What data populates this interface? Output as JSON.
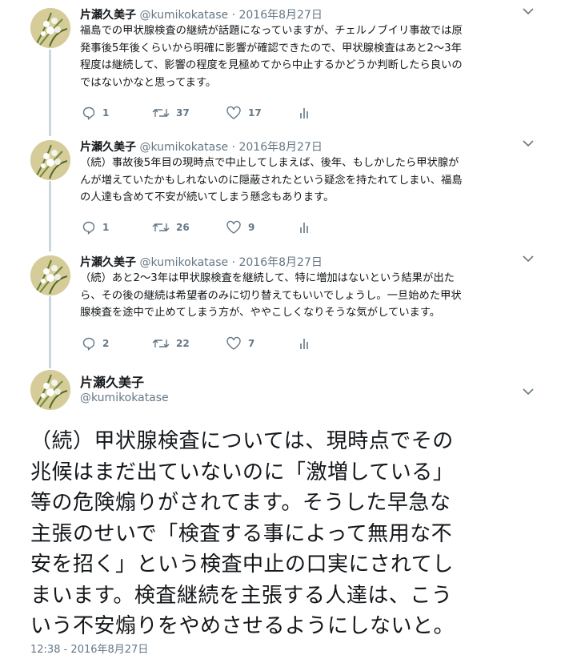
{
  "tweets": [
    {
      "name": "片瀬久美子",
      "handle": "@kumikokatase",
      "dot": "·",
      "date": "2016年8月27日",
      "text": "福島での甲状腺検査の継続が話題になっていますが、チェルノブイリ事故では原\n発事後5年後くらいから明確に影響が確認できたので、甲状腺検査はあと2〜3年\n程度は継続して、影響の程度を見極めてから中止するかどうか判断したら良いの\nではないかなと思ってます。",
      "replies": "1",
      "retweets": "37",
      "likes": "17"
    },
    {
      "name": "片瀬久美子",
      "handle": "@kumikokatase",
      "dot": "·",
      "date": "2016年8月27日",
      "text": "（続）事故後5年目の現時点で中止してしまえば、後年、もしかしたら甲状腺が\nんが増えていたかもしれないのに隠蔽されたという疑念を持たれてしまい、福島\nの人達も含めて不安が続いてしまう懸念もあります。",
      "replies": "1",
      "retweets": "26",
      "likes": "9"
    },
    {
      "name": "片瀬久美子",
      "handle": "@kumikokatase",
      "dot": "·",
      "date": "2016年8月27日",
      "text": "（続）あと2〜3年は甲状腺検査を継続して、特に増加はないという結果が出た\nら、その後の継続は希望者のみに切り替えてもいいでしょうし。一旦始めた甲状\n腺検査を途中で止めてしまう方が、ややこしくなりそうな気がしています。",
      "replies": "2",
      "retweets": "22",
      "likes": "7"
    }
  ],
  "main": {
    "name": "片瀬久美子",
    "handle": "@kumikokatase",
    "text": "（続）甲状腺検査については、現時点でその\n兆候はまだ出ていないのに「激増している」\n等の危険煽りがされてます。そうした早急な\n主張のせいで「検査する事によって無用な不\n安を招く」という検査中止の口実にされてし\nまいます。検査継続を主張する人達は、こう\nいう不安煽りをやめさせるようにしないと。",
    "timestamp": "12:38 - 2016年8月27日"
  },
  "icons": {
    "reply": "reply-icon",
    "retweet": "retweet-icon",
    "like": "heart-icon",
    "analytics": "analytics-icon",
    "menu": "chevron-down-icon"
  },
  "colors": {
    "text": "#14171a",
    "muted": "#657786",
    "thread_line": "#ccd6dd"
  }
}
